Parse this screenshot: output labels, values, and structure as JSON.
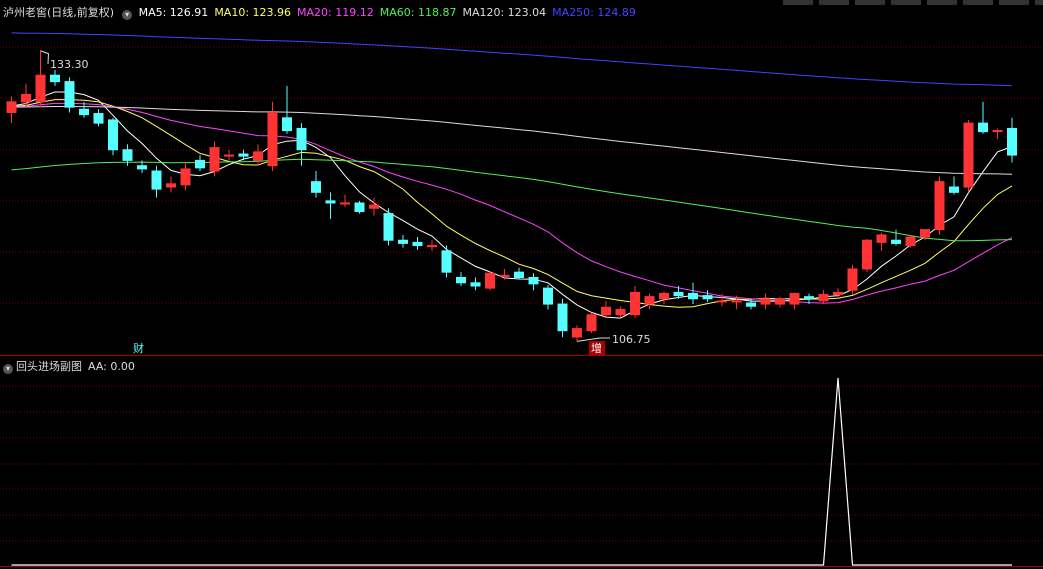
{
  "header": {
    "stock_name": "泸州老窖",
    "chart_mode": "(日线,前复权)"
  },
  "ma_legend": [
    {
      "label": "MA5: ",
      "value": "126.91",
      "color": "#ffffff"
    },
    {
      "label": "MA10: ",
      "value": "123.96",
      "color": "#ffff66"
    },
    {
      "label": "MA20: ",
      "value": "119.12",
      "color": "#ff44ff"
    },
    {
      "label": "MA60: ",
      "value": "118.87",
      "color": "#55ee55"
    },
    {
      "label": "MA120: ",
      "value": "123.04",
      "color": "#dddddd"
    },
    {
      "label": "MA250: ",
      "value": "124.89",
      "color": "#4444ff"
    }
  ],
  "subchart": {
    "title": "回头进场副图",
    "aa_label": "AA: ",
    "aa_value": "0.00"
  },
  "annotations": {
    "high_label": "133.30",
    "low_label": "106.75",
    "marker_cai": "财",
    "marker_zeng": "增"
  },
  "colors": {
    "up": "#ff3333",
    "down": "#55ffff",
    "grid": "#7a0000",
    "separator": "#aa0000"
  },
  "chart_data": {
    "type": "candlestick",
    "ylim": [
      105,
      136
    ],
    "candles": [
      [
        127.5,
        129.0,
        126.5,
        128.5
      ],
      [
        128.5,
        130.2,
        128.0,
        129.2
      ],
      [
        128.5,
        133.3,
        128.0,
        131.0
      ],
      [
        131.0,
        131.5,
        130.0,
        130.4
      ],
      [
        130.4,
        130.8,
        127.5,
        128.0
      ],
      [
        127.8,
        128.5,
        127.0,
        127.3
      ],
      [
        127.4,
        127.8,
        126.2,
        126.5
      ],
      [
        126.8,
        127.0,
        123.5,
        124.0
      ],
      [
        124.0,
        124.5,
        122.5,
        123.0
      ],
      [
        122.5,
        123.0,
        121.8,
        122.2
      ],
      [
        122.0,
        122.5,
        119.5,
        120.3
      ],
      [
        120.5,
        121.5,
        120.0,
        120.8
      ],
      [
        120.7,
        122.8,
        120.2,
        122.2
      ],
      [
        123.0,
        123.5,
        122.0,
        122.3
      ],
      [
        122.0,
        124.8,
        121.5,
        124.2
      ],
      [
        123.5,
        124.0,
        123.0,
        123.5
      ],
      [
        123.6,
        124.0,
        123.0,
        123.4
      ],
      [
        123.0,
        124.5,
        122.5,
        123.8
      ],
      [
        122.5,
        128.5,
        122.0,
        127.5
      ],
      [
        127.0,
        130.0,
        125.5,
        125.8
      ],
      [
        126.0,
        126.5,
        122.5,
        124.0
      ],
      [
        121.0,
        122.0,
        119.5,
        120.0
      ],
      [
        119.2,
        120.0,
        117.5,
        119.0
      ],
      [
        119.0,
        119.8,
        118.6,
        119.0
      ],
      [
        119.0,
        119.2,
        118.0,
        118.2
      ],
      [
        118.5,
        119.5,
        117.8,
        118.8
      ],
      [
        118.0,
        118.5,
        115.0,
        115.5
      ],
      [
        115.5,
        116.0,
        114.8,
        115.2
      ],
      [
        115.3,
        115.8,
        114.6,
        115.0
      ],
      [
        114.9,
        115.5,
        114.5,
        115.0
      ],
      [
        114.5,
        115.0,
        112.0,
        112.5
      ],
      [
        112.0,
        112.5,
        111.2,
        111.5
      ],
      [
        111.5,
        112.0,
        110.8,
        111.2
      ],
      [
        111.0,
        112.6,
        110.8,
        112.4
      ],
      [
        112.2,
        112.8,
        111.8,
        112.2
      ],
      [
        112.5,
        112.9,
        111.8,
        112.0
      ],
      [
        112.0,
        112.4,
        110.8,
        111.4
      ],
      [
        111.0,
        111.3,
        109.0,
        109.5
      ],
      [
        109.5,
        110.0,
        106.4,
        107.0
      ],
      [
        106.4,
        107.5,
        106.0,
        107.2
      ],
      [
        107.0,
        108.7,
        106.8,
        108.5
      ],
      [
        108.5,
        109.8,
        108.3,
        109.2
      ],
      [
        108.5,
        109.3,
        108.2,
        109.0
      ],
      [
        108.5,
        111.2,
        108.2,
        110.6
      ],
      [
        109.5,
        110.5,
        109.0,
        110.2
      ],
      [
        110.0,
        110.7,
        109.5,
        110.5
      ],
      [
        110.6,
        111.2,
        110.0,
        110.3
      ],
      [
        110.5,
        111.5,
        109.5,
        110.0
      ],
      [
        110.3,
        110.8,
        109.7,
        110.0
      ],
      [
        109.8,
        110.5,
        109.3,
        109.8
      ],
      [
        109.8,
        110.3,
        109.0,
        109.8
      ],
      [
        109.6,
        110.0,
        109.0,
        109.3
      ],
      [
        109.5,
        110.5,
        109.0,
        110.0
      ],
      [
        109.5,
        110.2,
        109.2,
        110.0
      ],
      [
        109.5,
        110.6,
        109.0,
        110.5
      ],
      [
        110.2,
        110.5,
        109.5,
        110.0
      ],
      [
        109.8,
        110.8,
        109.5,
        110.4
      ],
      [
        110.4,
        111.0,
        110.0,
        110.6
      ],
      [
        110.8,
        113.2,
        110.4,
        112.8
      ],
      [
        112.8,
        115.6,
        112.5,
        115.5
      ],
      [
        115.3,
        116.2,
        114.5,
        116.0
      ],
      [
        115.5,
        116.5,
        115.0,
        115.2
      ],
      [
        115.0,
        116.0,
        114.8,
        115.8
      ],
      [
        115.8,
        116.5,
        115.5,
        116.5
      ],
      [
        116.5,
        121.5,
        116.0,
        121.0
      ],
      [
        120.5,
        121.5,
        119.8,
        120.0
      ],
      [
        120.5,
        126.8,
        120.0,
        126.5
      ],
      [
        126.5,
        128.5,
        125.5,
        125.7
      ],
      [
        125.7,
        126.0,
        125.0,
        125.8
      ],
      [
        126.0,
        127.0,
        122.8,
        123.5
      ]
    ],
    "subchart_series": {
      "name": "AA",
      "values": [
        0,
        0,
        0,
        0,
        0,
        0,
        0,
        0,
        0,
        0,
        0,
        0,
        0,
        0,
        0,
        0,
        0,
        0,
        0,
        0,
        0,
        0,
        0,
        0,
        0,
        0,
        0,
        0,
        0,
        0,
        0,
        0,
        0,
        0,
        0,
        0,
        0,
        0,
        0,
        0,
        0,
        0,
        0,
        0,
        0,
        0,
        0,
        0,
        0,
        0,
        0,
        0,
        0,
        0,
        0,
        0,
        0,
        1,
        0,
        0,
        0,
        0,
        0,
        0,
        0,
        0,
        0,
        0,
        0,
        0
      ],
      "ylim": [
        0,
        1
      ]
    }
  }
}
